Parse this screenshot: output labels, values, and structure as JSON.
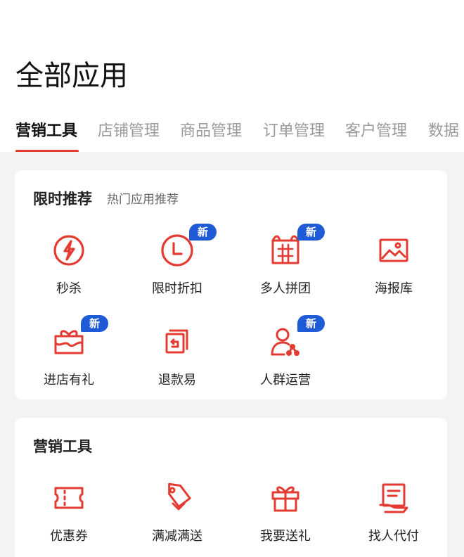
{
  "header": {
    "title": "全部应用"
  },
  "tabs": [
    {
      "label": "营销工具",
      "active": true
    },
    {
      "label": "店铺管理"
    },
    {
      "label": "商品管理"
    },
    {
      "label": "订单管理"
    },
    {
      "label": "客户管理"
    },
    {
      "label": "数据"
    }
  ],
  "colors": {
    "accent": "#e33b32",
    "badge": "#1f5bd6",
    "background": "#f3f3f5"
  },
  "badge_label": "新",
  "recommend": {
    "title": "限时推荐",
    "subtitle": "热门应用推荐",
    "items": [
      {
        "label": "秒杀",
        "icon": "lightning-circle-icon"
      },
      {
        "label": "限时折扣",
        "icon": "clock-icon",
        "badge": "新"
      },
      {
        "label": "多人拼团",
        "icon": "group-buy-icon",
        "badge": "新"
      },
      {
        "label": "海报库",
        "icon": "image-icon"
      },
      {
        "label": "进店有礼",
        "icon": "gift-box-icon",
        "badge": "新"
      },
      {
        "label": "退款易",
        "icon": "refund-icon"
      },
      {
        "label": "人群运营",
        "icon": "user-network-icon",
        "badge": "新"
      }
    ]
  },
  "marketing": {
    "title": "营销工具",
    "items": [
      {
        "label": "优惠券",
        "icon": "coupon-icon"
      },
      {
        "label": "满减满送",
        "icon": "price-tag-icon"
      },
      {
        "label": "我要送礼",
        "icon": "gift-icon"
      },
      {
        "label": "找人代付",
        "icon": "pay-for-me-icon"
      }
    ]
  }
}
